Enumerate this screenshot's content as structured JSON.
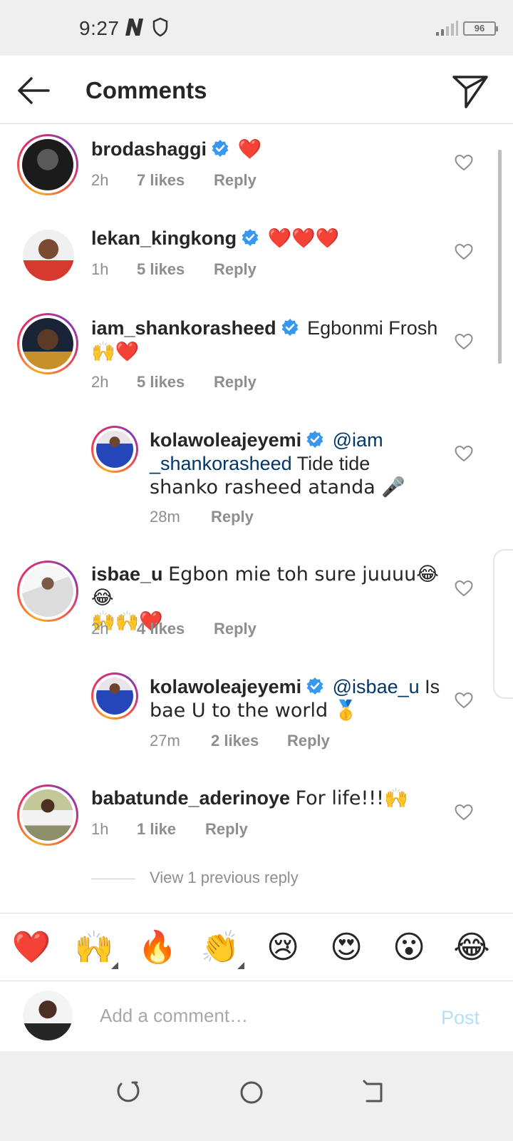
{
  "status_bar": {
    "time": "9:27",
    "battery": "96"
  },
  "header": {
    "title": "Comments",
    "back_icon": "arrow-left-icon",
    "send_icon": "paper-plane-icon"
  },
  "comments": [
    {
      "username": "brodashaggi",
      "verified": true,
      "text": "❤️",
      "time": "2h",
      "likes": "7 likes",
      "reply": "Reply"
    },
    {
      "username": "lekan_kingkong",
      "verified": true,
      "text": "❤️❤️❤️",
      "time": "1h",
      "likes": "5 likes",
      "reply": "Reply"
    },
    {
      "username": "iam_shankorasheed",
      "verified": true,
      "text": "Egbonmi Frosh",
      "text2": "🙌❤️",
      "time": "2h",
      "likes": "5 likes",
      "reply": "Reply"
    },
    {
      "username": "kolawoleajeyemi",
      "verified": true,
      "mention": "@iam",
      "mention2": "_shankorasheed",
      "text": " Tide tide",
      "text2": "shanko rasheed atanda 🎤",
      "time": "28m",
      "reply": "Reply",
      "is_reply": true
    },
    {
      "username": "isbae_u",
      "verified": false,
      "text": "Egbon mie toh sure juuuu😂😂",
      "text2": "🙌🙌❤️",
      "time": "2h",
      "likes": "4 likes",
      "reply": "Reply"
    },
    {
      "username": "kolawoleajeyemi",
      "verified": true,
      "mention": "@isbae_u",
      "text": " Is",
      "text2": "bae U to the world 🥇",
      "time": "27m",
      "likes": "2 likes",
      "reply": "Reply",
      "is_reply": true
    },
    {
      "username": "babatunde_aderinoye",
      "verified": false,
      "text": "For life!!!🙌",
      "time": "1h",
      "likes": "1 like",
      "reply": "Reply"
    }
  ],
  "view_replies": "View 1 previous reply",
  "emoji_bar": [
    "❤️",
    "🙌",
    "🔥",
    "👏",
    "😢",
    "😍",
    "😮",
    "😂"
  ],
  "compose": {
    "placeholder": "Add a comment…",
    "post": "Post"
  },
  "colors": {
    "accent": "#0095f6",
    "post_disabled": "#b2dffc",
    "verified": "#3897f0",
    "heart": "#e0163a"
  }
}
